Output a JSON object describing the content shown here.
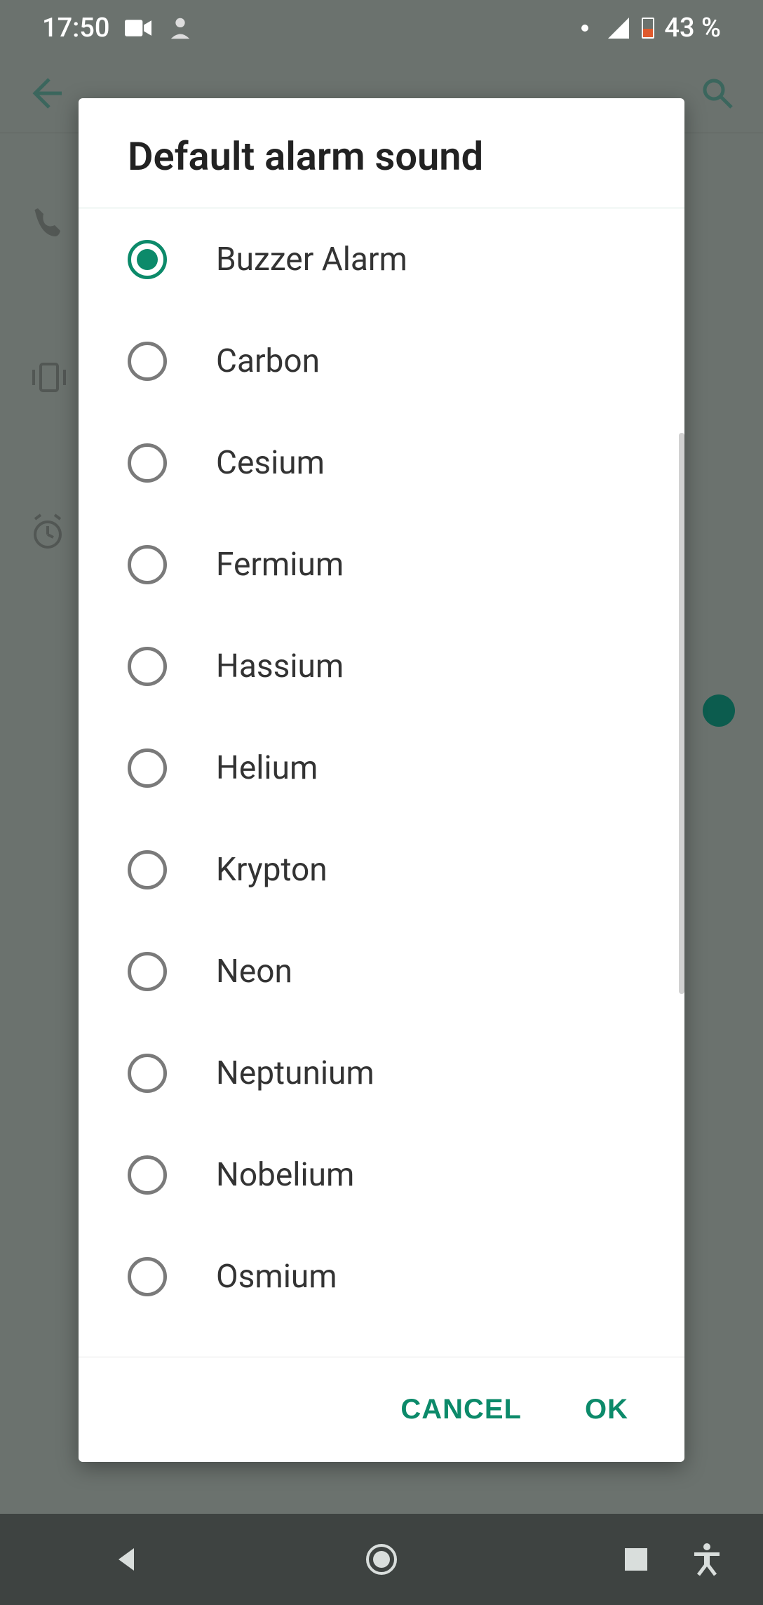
{
  "status_bar": {
    "time": "17:50",
    "battery_text": "43 %"
  },
  "dialog": {
    "title": "Default alarm sound",
    "selected_index": 0,
    "options": [
      "Buzzer Alarm",
      "Carbon",
      "Cesium",
      "Fermium",
      "Hassium",
      "Helium",
      "Krypton",
      "Neon",
      "Neptunium",
      "Nobelium",
      "Osmium"
    ],
    "cancel_label": "CANCEL",
    "ok_label": "OK"
  }
}
